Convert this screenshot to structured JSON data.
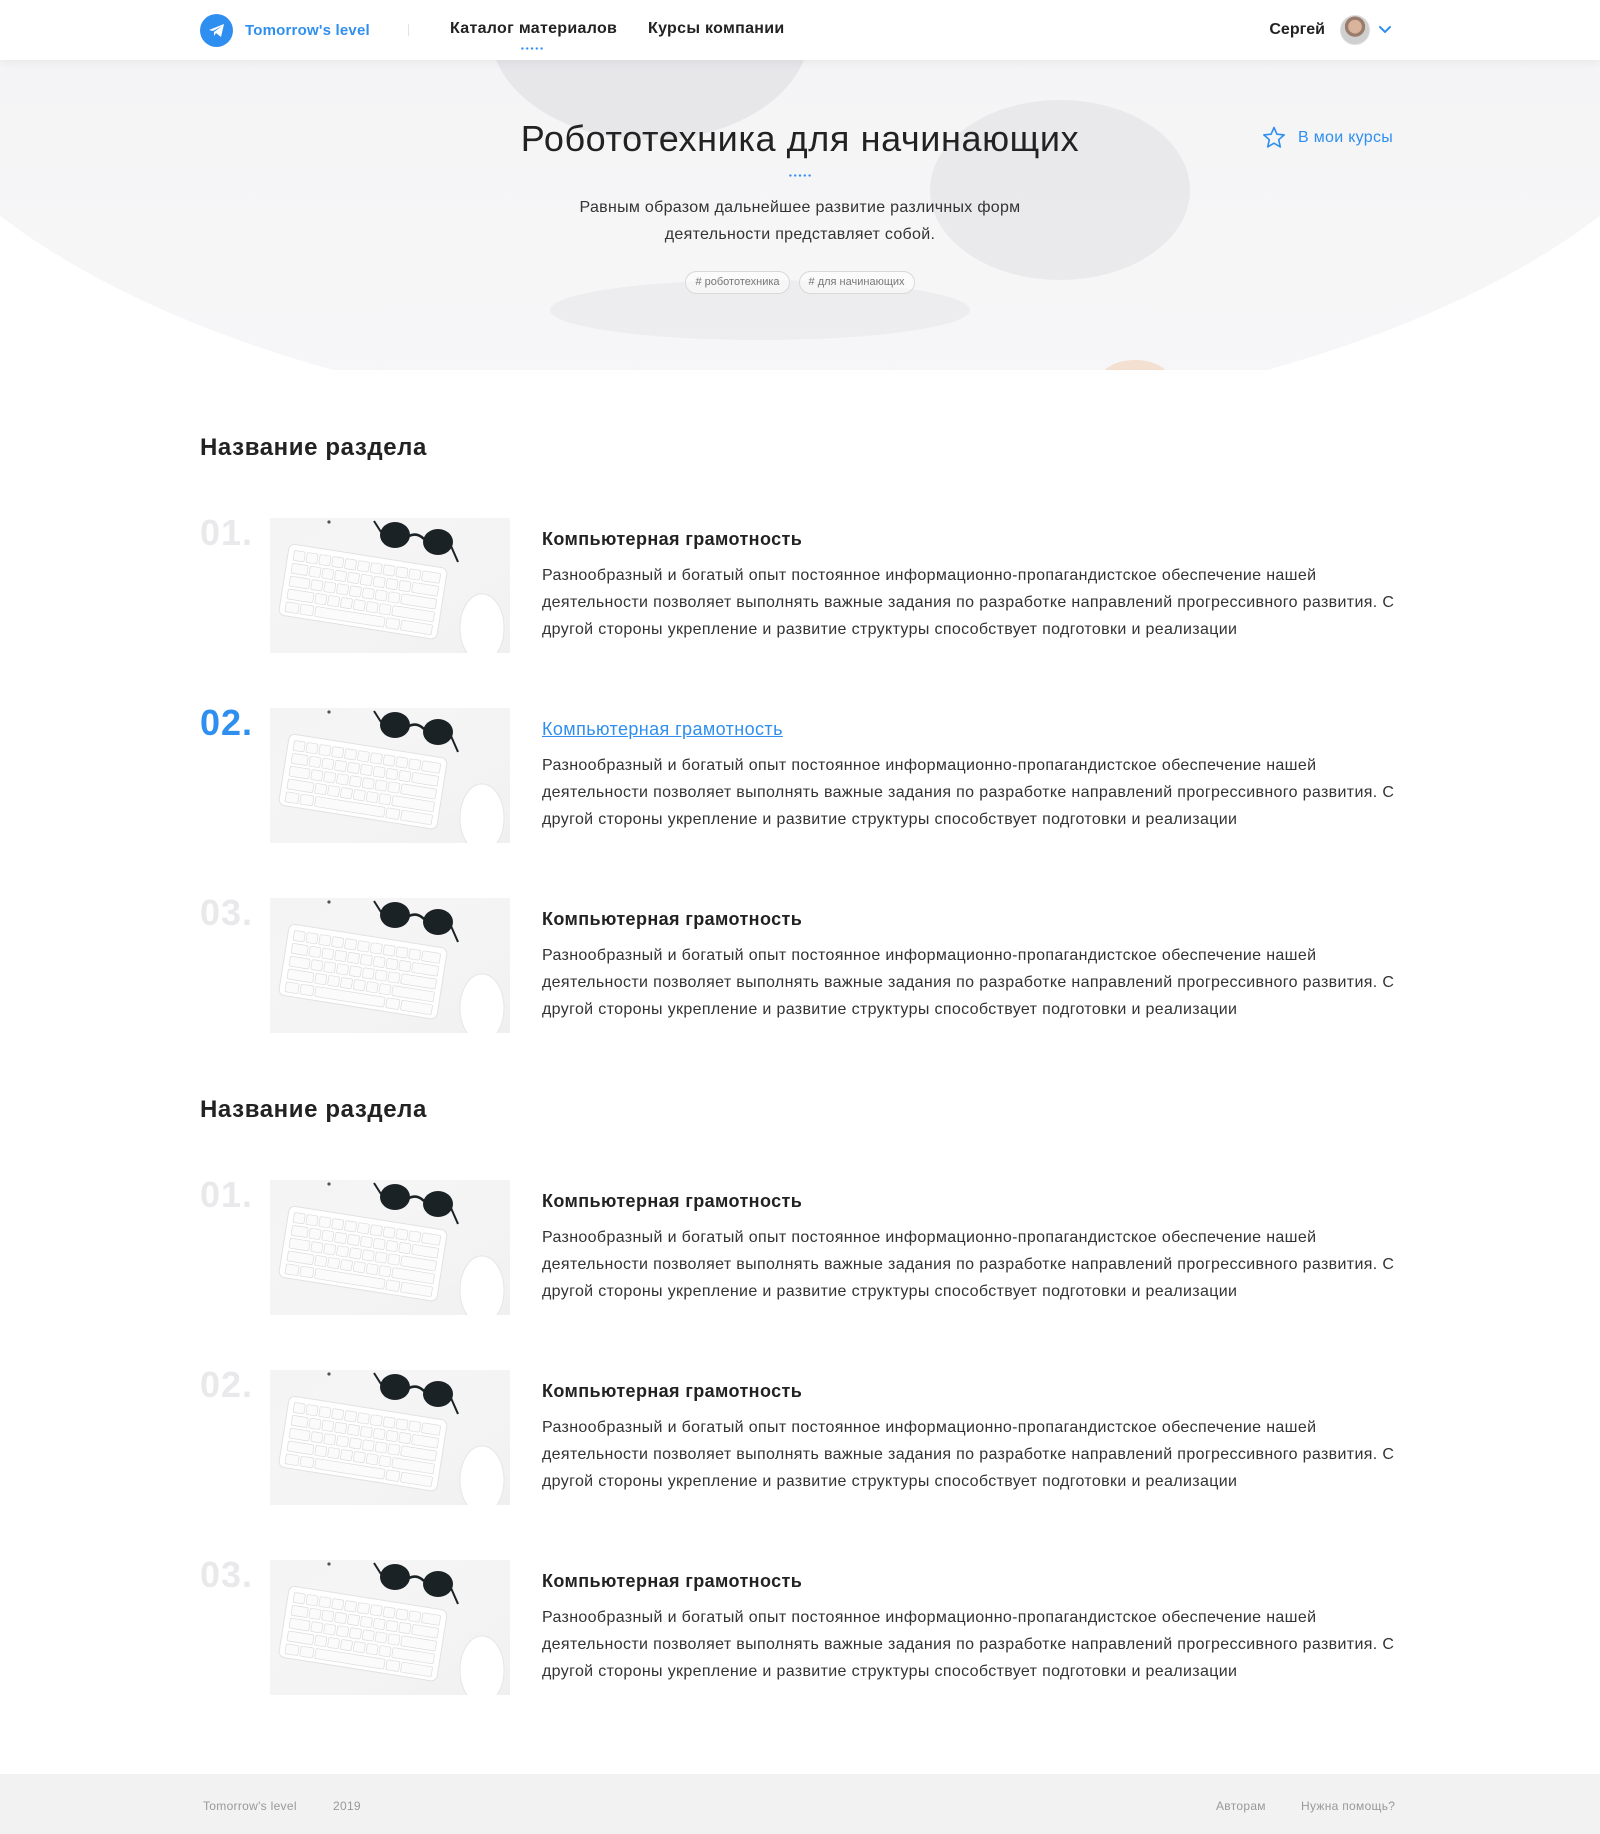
{
  "header": {
    "logo_text": "Tomorrow's level",
    "nav": [
      {
        "label": "Каталог материалов"
      },
      {
        "label": "Курсы компании"
      }
    ],
    "user_name": "Сергей",
    "brand_color": "#2f8ff0"
  },
  "hero": {
    "title": "Робототехника для начинающих",
    "description": "Равным образом дальнейшее развитие различных форм деятельности представляет собой.",
    "tags": [
      "# робототехника",
      "# для начинающих"
    ],
    "favorite_label": "В мои курсы"
  },
  "sections": [
    {
      "title": "Название раздела",
      "items": [
        {
          "num": "01.",
          "title": "Компьютерная грамотность",
          "desc": "Разнообразный и богатый опыт постоянное информационно-пропагандистское обеспечение нашей деятельности позволяет выполнять важные задания по разработке направлений прогрессивного развития. С другой стороны укрепление и развитие структуры способствует подготовки и реализации"
        },
        {
          "num": "02.",
          "title": "Компьютерная грамотность",
          "desc": "Разнообразный и богатый опыт постоянное информационно-пропагандистское обеспечение нашей деятельности позволяет выполнять важные задания по разработке направлений прогрессивного развития. С другой стороны укрепление и развитие структуры способствует подготовки и реализации"
        },
        {
          "num": "03.",
          "title": "Компьютерная грамотность",
          "desc": "Разнообразный и богатый опыт постоянное информационно-пропагандистское обеспечение нашей деятельности позволяет выполнять важные задания по разработке направлений прогрессивного развития. С другой стороны укрепление и развитие структуры способствует подготовки и реализации"
        }
      ]
    },
    {
      "title": "Название раздела",
      "items": [
        {
          "num": "01.",
          "title": "Компьютерная грамотность",
          "desc": "Разнообразный и богатый опыт постоянное информационно-пропагандистское обеспечение нашей деятельности позволяет выполнять важные задания по разработке направлений прогрессивного развития. С другой стороны укрепление и развитие структуры способствует подготовки и реализации"
        },
        {
          "num": "02.",
          "title": "Компьютерная грамотность",
          "desc": "Разнообразный и богатый опыт постоянное информационно-пропагандистское обеспечение нашей деятельности позволяет выполнять важные задания по разработке направлений прогрессивного развития. С другой стороны укрепление и развитие структуры способствует подготовки и реализации"
        },
        {
          "num": "03.",
          "title": "Компьютерная грамотность",
          "desc": "Разнообразный и богатый опыт постоянное информационно-пропагандистское обеспечение нашей деятельности позволяет выполнять важные задания по разработке направлений прогрессивного развития. С другой стороны укрепление и развитие структуры способствует подготовки и реализации"
        }
      ]
    }
  ],
  "footer": {
    "brand": "Tomorrow's level",
    "year": "2019",
    "authors_link": "Авторам",
    "help_link": "Нужна помощь?"
  }
}
